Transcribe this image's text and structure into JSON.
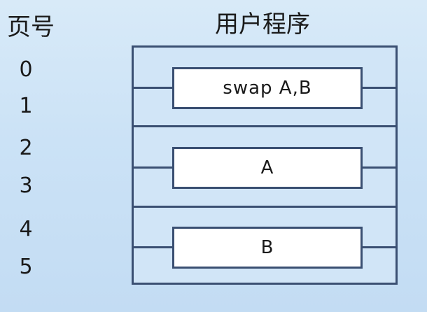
{
  "headers": {
    "page_number": "页号",
    "user_program": "用户程序"
  },
  "page_numbers": [
    "0",
    "1",
    "2",
    "3",
    "4",
    "5"
  ],
  "modules": [
    {
      "label": "swap A,B"
    },
    {
      "label": "A"
    },
    {
      "label": "B"
    }
  ]
}
